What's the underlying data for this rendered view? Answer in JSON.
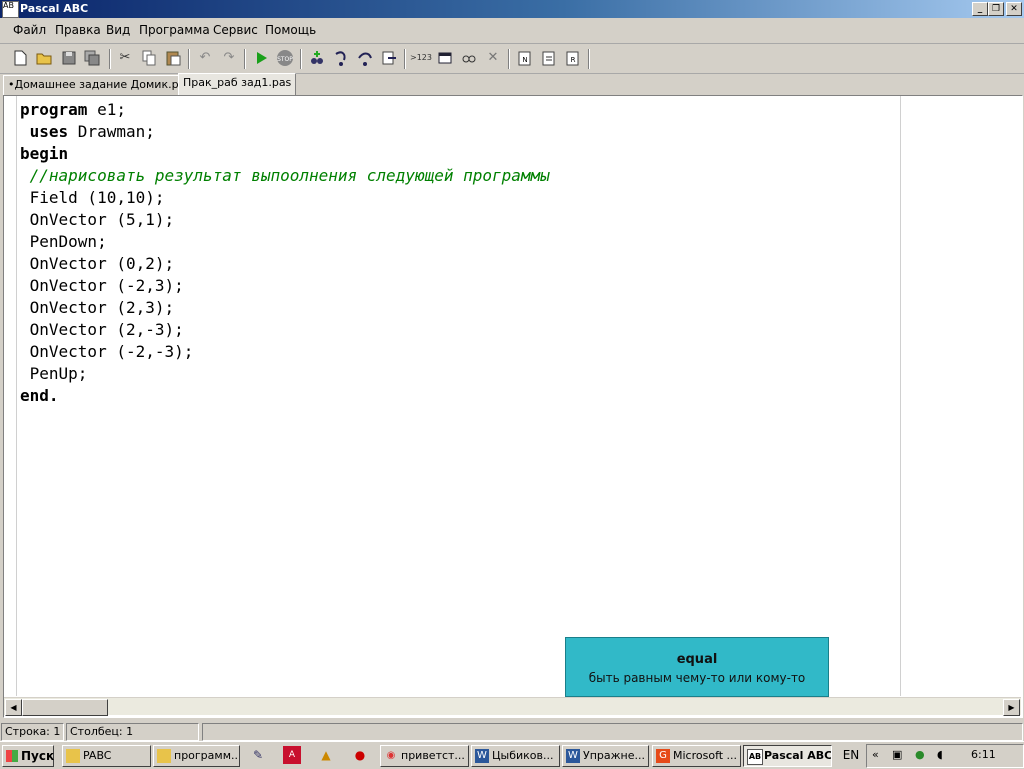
{
  "window": {
    "title": "Pascal ABC",
    "icon_text": "AB",
    "controls": [
      "_",
      "❐",
      "✕"
    ]
  },
  "menu": [
    "Файл",
    "Правка",
    "Вид",
    "Программа",
    "Сервис",
    "Помощь"
  ],
  "toolbar_icons": [
    "new-file",
    "open-folder",
    "save",
    "save-all",
    "cut",
    "copy",
    "paste",
    "undo",
    "redo",
    "run",
    "stop",
    "add-watch",
    "step-into",
    "step-over",
    "run-to-cursor",
    "output",
    "window",
    "format",
    "close",
    "export-1",
    "export-2",
    "export-3"
  ],
  "toolbar": {
    "digits_label": ">123"
  },
  "tabs": [
    {
      "label": "•Домашнее задание Домик.pas",
      "active": false
    },
    {
      "label": "Прак_раб зад1.pas",
      "active": true
    }
  ],
  "code_lines": [
    {
      "parts": [
        {
          "t": "program",
          "k": "kw"
        },
        {
          "t": " e1;",
          "k": ""
        }
      ]
    },
    {
      "parts": [
        {
          "t": " uses",
          "k": "kw"
        },
        {
          "t": " Drawman;",
          "k": ""
        }
      ]
    },
    {
      "parts": [
        {
          "t": "begin",
          "k": "kw"
        }
      ]
    },
    {
      "parts": [
        {
          "t": " //нарисовать результат выпоолнения следующей программы",
          "k": "cm"
        }
      ]
    },
    {
      "parts": [
        {
          "t": " Field (10,10);",
          "k": ""
        }
      ]
    },
    {
      "parts": [
        {
          "t": " OnVector (5,1);",
          "k": ""
        }
      ]
    },
    {
      "parts": [
        {
          "t": " PenDown;",
          "k": ""
        }
      ]
    },
    {
      "parts": [
        {
          "t": " OnVector (0,2);",
          "k": ""
        }
      ]
    },
    {
      "parts": [
        {
          "t": " OnVector (-2,3);",
          "k": ""
        }
      ]
    },
    {
      "parts": [
        {
          "t": " OnVector (2,3);",
          "k": ""
        }
      ]
    },
    {
      "parts": [
        {
          "t": " OnVector (2,-3);",
          "k": ""
        }
      ]
    },
    {
      "parts": [
        {
          "t": " OnVector (-2,-3);",
          "k": ""
        }
      ]
    },
    {
      "parts": [
        {
          "t": " PenUp;",
          "k": ""
        }
      ]
    },
    {
      "parts": [
        {
          "t": "end.",
          "k": "kw"
        }
      ]
    }
  ],
  "tooltip": {
    "word": "equal",
    "definition": "быть равным чему-то или кому-то"
  },
  "status": {
    "line": "Строка: 1",
    "column": "Столбец: 1"
  },
  "taskbar": {
    "start_label": "Пуск",
    "tasks": [
      {
        "label": "PABC",
        "icon": "folder-icon",
        "active": false
      },
      {
        "label": "программ...",
        "icon": "folder-icon",
        "active": false
      },
      {
        "label": "приветст...",
        "icon": "chrome-icon",
        "active": false
      },
      {
        "label": "Цыбиков...",
        "icon": "word-icon",
        "active": false
      },
      {
        "label": "Упражне...",
        "icon": "word-icon",
        "active": false
      },
      {
        "label": "Microsoft ...",
        "icon": "office-icon",
        "active": false
      },
      {
        "label": "Pascal ABC",
        "icon": "pascal-icon",
        "active": true
      }
    ],
    "language": "EN",
    "clock": "6:11"
  },
  "colors": {
    "tooltip_bg": "#31b9c8",
    "comment": "#008000",
    "titlebar": "#0a246a"
  }
}
